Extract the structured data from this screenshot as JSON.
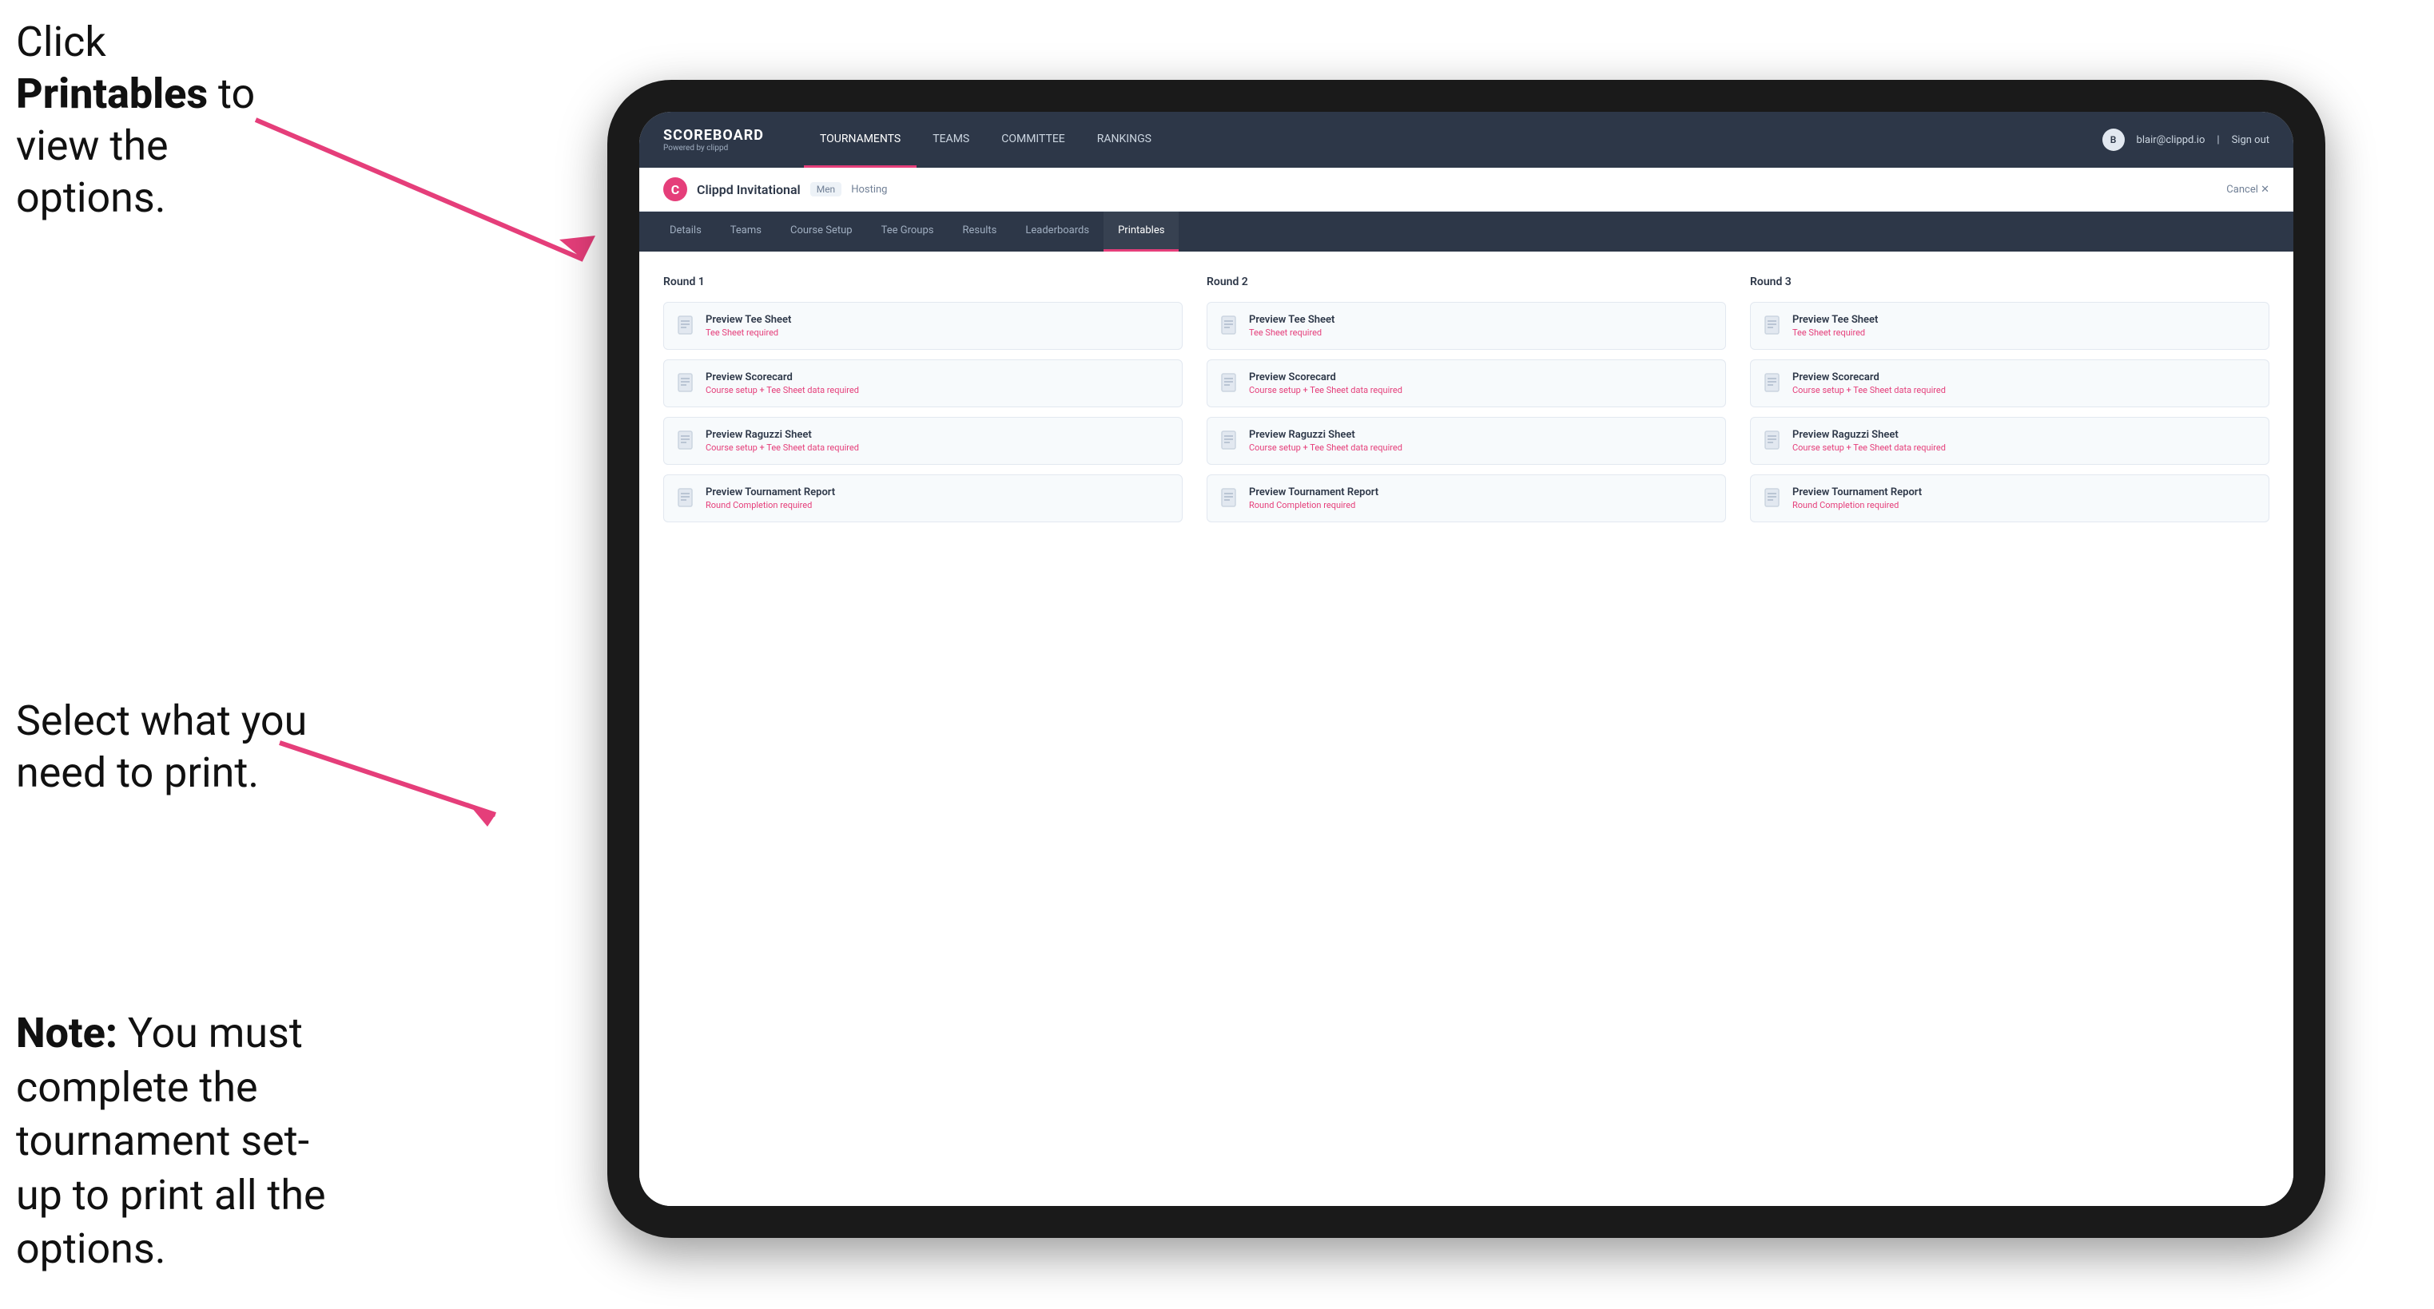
{
  "annotations": {
    "top": "Click ",
    "top_bold": "Printables",
    "top_rest": " to view the options.",
    "middle": "Select what you need to print.",
    "bottom_bold": "Note:",
    "bottom_rest": " You must complete the tournament set-up to print all the options."
  },
  "nav": {
    "logo": "SCOREBOARD",
    "logo_sub": "Powered by clippd",
    "links": [
      "TOURNAMENTS",
      "TEAMS",
      "COMMITTEE",
      "RANKINGS"
    ],
    "active_link": "TOURNAMENTS",
    "user_email": "blair@clippd.io",
    "sign_out": "Sign out"
  },
  "tournament": {
    "logo_letter": "C",
    "name": "Clippd Invitational",
    "badge": "Men",
    "status": "Hosting",
    "cancel": "Cancel  ✕"
  },
  "sub_nav": {
    "tabs": [
      "Details",
      "Teams",
      "Course Setup",
      "Tee Groups",
      "Results",
      "Leaderboards",
      "Printables"
    ],
    "active_tab": "Printables"
  },
  "rounds": [
    {
      "label": "Round 1",
      "items": [
        {
          "title": "Preview Tee Sheet",
          "subtitle": "Tee Sheet required"
        },
        {
          "title": "Preview Scorecard",
          "subtitle": "Course setup + Tee Sheet data required"
        },
        {
          "title": "Preview Raguzzi Sheet",
          "subtitle": "Course setup + Tee Sheet data required"
        },
        {
          "title": "Preview Tournament Report",
          "subtitle": "Round Completion required"
        }
      ]
    },
    {
      "label": "Round 2",
      "items": [
        {
          "title": "Preview Tee Sheet",
          "subtitle": "Tee Sheet required"
        },
        {
          "title": "Preview Scorecard",
          "subtitle": "Course setup + Tee Sheet data required"
        },
        {
          "title": "Preview Raguzzi Sheet",
          "subtitle": "Course setup + Tee Sheet data required"
        },
        {
          "title": "Preview Tournament Report",
          "subtitle": "Round Completion required"
        }
      ]
    },
    {
      "label": "Round 3",
      "items": [
        {
          "title": "Preview Tee Sheet",
          "subtitle": "Tee Sheet required"
        },
        {
          "title": "Preview Scorecard",
          "subtitle": "Course setup + Tee Sheet data required"
        },
        {
          "title": "Preview Raguzzi Sheet",
          "subtitle": "Course setup + Tee Sheet data required"
        },
        {
          "title": "Preview Tournament Report",
          "subtitle": "Round Completion required"
        }
      ]
    }
  ]
}
